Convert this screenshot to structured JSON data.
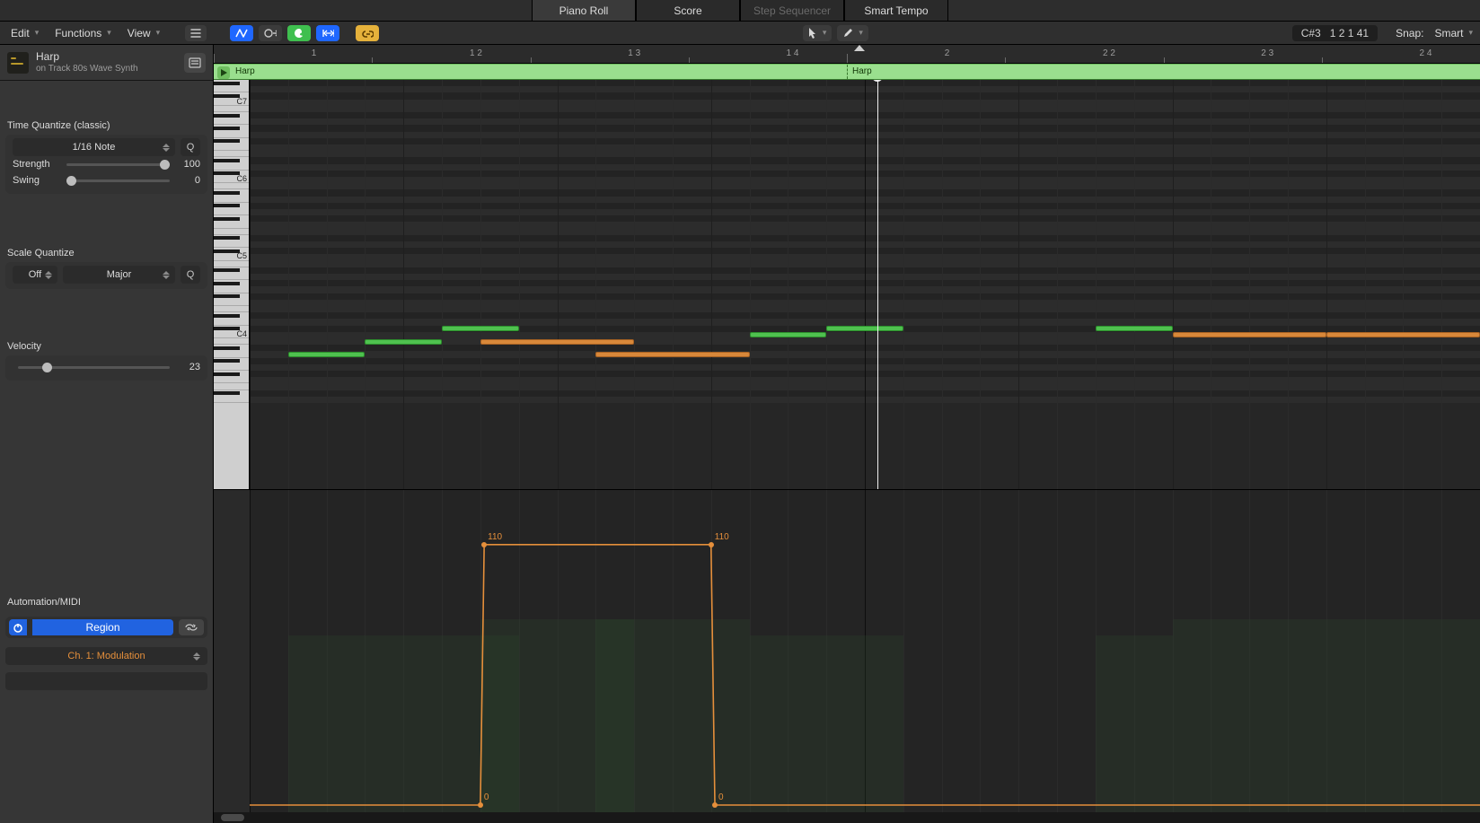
{
  "tabs": {
    "piano_roll": "Piano Roll",
    "score": "Score",
    "step_sequencer": "Step Sequencer",
    "smart_tempo": "Smart Tempo",
    "selected": "piano_roll",
    "disabled": "step_sequencer"
  },
  "menu": {
    "edit": "Edit",
    "functions": "Functions",
    "view": "View"
  },
  "cursor": {
    "note": "C#3",
    "position": "1 2 1 41",
    "snap_label": "Snap:",
    "snap_value": "Smart"
  },
  "track": {
    "name": "Harp",
    "sub": "on Track 80s Wave Synth"
  },
  "time_quantize": {
    "label": "Time Quantize (classic)",
    "value": "1/16 Note",
    "strength_label": "Strength",
    "strength_value": "100",
    "swing_label": "Swing",
    "swing_value": "0"
  },
  "scale_quantize": {
    "label": "Scale Quantize",
    "onoff": "Off",
    "mode": "Major"
  },
  "velocity": {
    "label": "Velocity",
    "value": "23"
  },
  "automation": {
    "label": "Automation/MIDI",
    "region": "Region",
    "channel": "Ch. 1: Modulation",
    "points": [
      {
        "v": 0,
        "label": "0"
      },
      {
        "v": 110,
        "label": "110"
      },
      {
        "v": 110,
        "label": "110"
      },
      {
        "v": 0,
        "label": "0"
      }
    ]
  },
  "region": {
    "name": "Harp",
    "name2": "Harp"
  },
  "ruler": {
    "ticks": [
      "1",
      "1 2",
      "1 3",
      "1 4",
      "2",
      "2 2",
      "2 3",
      "2 4"
    ]
  },
  "keyboard": {
    "labels": [
      "C7",
      "C6",
      "C5",
      "C4"
    ]
  },
  "playhead_pos": 0.51,
  "chart_data": {
    "type": "table",
    "description": "MIDI notes visible in Piano Roll (two identical one-bar loops). Pitch approximate from grid, start/length in 16ths from bar start, color encodes velocity (green≈low, orange≈higher).",
    "columns": [
      "pitch",
      "start_16th",
      "length_16th",
      "color"
    ],
    "rows": [
      [
        "A3",
        1,
        2,
        "green"
      ],
      [
        "B3",
        3,
        2,
        "green"
      ],
      [
        "C#4",
        5,
        2,
        "green"
      ],
      [
        "B3",
        6,
        4,
        "orange"
      ],
      [
        "A3",
        9,
        4,
        "orange"
      ],
      [
        "C4",
        13,
        2,
        "green"
      ],
      [
        "C#4",
        15,
        2,
        "green"
      ],
      [
        "C#4",
        22,
        2,
        "green"
      ],
      [
        "C4",
        24,
        4,
        "orange"
      ],
      [
        "C4",
        28,
        4,
        "orange"
      ]
    ],
    "automation": {
      "parameter": "Ch. 1: Modulation",
      "range": [
        0,
        127
      ],
      "breakpoints": [
        {
          "beat": 1.0,
          "value": 0
        },
        {
          "beat": 1.95,
          "value": 0
        },
        {
          "beat": 2.0,
          "value": 110
        },
        {
          "beat": 2.95,
          "value": 110
        },
        {
          "beat": 3.0,
          "value": 0
        }
      ]
    }
  }
}
